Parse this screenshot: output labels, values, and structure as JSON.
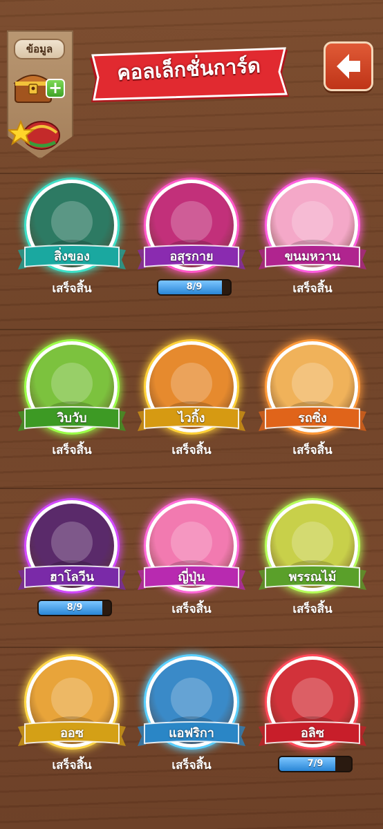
{
  "header": {
    "info_label": "ข้อมูล",
    "title": "คอลเล็กชั่นการ์ด",
    "back_icon": "arrow-left-icon"
  },
  "colors": {
    "complete_text": "#ffffff",
    "progress_fill": "#2a86d6",
    "title_banner": "#d81f26"
  },
  "cards": [
    {
      "name": "สิ่งของ",
      "status": "เสร็จสิ้น",
      "complete": true,
      "ribbon": "#1aa8a0",
      "glow": "#3fe0c8",
      "bg": "#2d7a63",
      "icon": "bottle-icon"
    },
    {
      "name": "อสุรกาย",
      "status": "8/9",
      "complete": false,
      "progress": 0.889,
      "ribbon": "#8a2bb0",
      "glow": "#ff58c8",
      "bg": "#c2307a",
      "icon": "dragon-icon"
    },
    {
      "name": "ขนมหวาน",
      "status": "เสร็จสิ้น",
      "complete": true,
      "ribbon": "#b0248f",
      "glow": "#ff5ee0",
      "bg": "#f4a8c8",
      "icon": "donut-icon"
    },
    {
      "name": "วิบวับ",
      "status": "เสร็จสิ้น",
      "complete": true,
      "ribbon": "#3d9a24",
      "glow": "#9cff4a",
      "bg": "#7cc23e",
      "icon": "captain-icon"
    },
    {
      "name": "ไวกิ้ง",
      "status": "เสร็จสิ้น",
      "complete": true,
      "ribbon": "#d69a12",
      "glow": "#ffd23a",
      "bg": "#e68a2e",
      "icon": "viking-icon"
    },
    {
      "name": "รถซิ่ง",
      "status": "เสร็จสิ้น",
      "complete": true,
      "ribbon": "#e0641a",
      "glow": "#ff9a3a",
      "bg": "#f0b25a",
      "icon": "car-icon"
    },
    {
      "name": "ฮาโลวีน",
      "status": "8/9",
      "complete": false,
      "progress": 0.889,
      "ribbon": "#7a2aa8",
      "glow": "#d24aff",
      "bg": "#5a2a6a",
      "icon": "pumpkin-icon"
    },
    {
      "name": "ญี่ปุ่น",
      "status": "เสร็จสิ้น",
      "complete": true,
      "ribbon": "#b82ab0",
      "glow": "#ff6ad8",
      "bg": "#f27ab0",
      "icon": "girl-icon"
    },
    {
      "name": "พรรณไม้",
      "status": "เสร็จสิ้น",
      "complete": true,
      "ribbon": "#5aa02a",
      "glow": "#b6ff5a",
      "bg": "#c8d04a",
      "icon": "tulip-icon"
    },
    {
      "name": "ออซ",
      "status": "เสร็จสิ้น",
      "complete": true,
      "ribbon": "#d4a016",
      "glow": "#ffd84a",
      "bg": "#e8a43a",
      "icon": "scarecrow-icon"
    },
    {
      "name": "แอฟริกา",
      "status": "เสร็จสิ้น",
      "complete": true,
      "ribbon": "#2a86c6",
      "glow": "#5ad0ff",
      "bg": "#3a8ac8",
      "icon": "rhino-icon"
    },
    {
      "name": "อลิซ",
      "status": "7/9",
      "complete": false,
      "progress": 0.778,
      "ribbon": "#c81e2a",
      "glow": "#ff4a5a",
      "bg": "#d2323a",
      "icon": "rabbit-icon"
    }
  ]
}
